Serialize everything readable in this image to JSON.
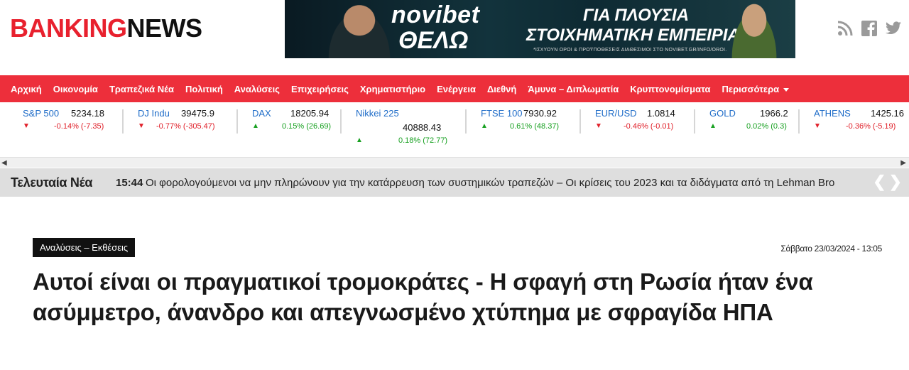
{
  "logo": {
    "part1": "BANKING",
    "part2": "NEWS"
  },
  "ad": {
    "brand": "novibet",
    "brand_line2": "ΘΕΛΩ",
    "slogan_line1": "ΓΙΑ ΠΛΟΥΣΙΑ",
    "slogan_line2": "ΣΤΟΙΧΗΜΑΤΙΚΗ ΕΜΠΕΙΡΙΑ",
    "fine_print": "*ΙΣΧΥΟΥΝ ΟΡΟΙ & ΠΡΟΫΠΟΘΕΣΕΙΣ ΔΙΑΘΕΣΙΜΟΙ ΣΤΟ NOVIBET.GR/INFO/OROI."
  },
  "social": [
    "rss-icon",
    "facebook-icon",
    "twitter-icon"
  ],
  "nav": {
    "items": [
      "Αρχική",
      "Οικονομία",
      "Τραπεζικά Νέα",
      "Πολιτική",
      "Αναλύσεις",
      "Επιχειρήσεις",
      "Χρηματιστήριο",
      "Ενέργεια",
      "Διεθνή",
      "Άμυνα – Διπλωματία",
      "Κρυπτονομίσματα"
    ],
    "more": "Περισσότερα"
  },
  "tickers": [
    {
      "name": "S&P 500",
      "price": "5234.18",
      "change": "-0.14% (-7.35)",
      "dir": "down"
    },
    {
      "name": "DJ Indu",
      "price": "39475.9",
      "change": "-0.77% (-305.47)",
      "dir": "down"
    },
    {
      "name": "DAX",
      "price": "18205.94",
      "change": "0.15% (26.69)",
      "dir": "up"
    },
    {
      "name": "Nikkei 225",
      "price": "40888.43",
      "change": "0.18% (72.77)",
      "dir": "up"
    },
    {
      "name": "FTSE 100",
      "price": "7930.92",
      "change": "0.61% (48.37)",
      "dir": "up"
    },
    {
      "name": "EUR/USD",
      "price": "1.0814",
      "change": "-0.46% (-0.01)",
      "dir": "down"
    },
    {
      "name": "GOLD",
      "price": "1966.2",
      "change": "0.02% (0.3)",
      "dir": "up"
    },
    {
      "name": "ATHENS",
      "price": "1425.16",
      "change": "-0.36% (-5.19)",
      "dir": "down"
    }
  ],
  "latest": {
    "label": "Τελευταία Νέα",
    "time": "15:44",
    "headline": "Οι φορολογούμενοι να μην πληρώνουν για την κατάρρευση των συστημικών τραπεζών – Οι κρίσεις του 2023 και τα διδάγματα από τη Lehman Bro"
  },
  "article": {
    "category": "Αναλύσεις – Εκθέσεις",
    "date": "Σάββατο 23/03/2024 - 13:05",
    "title": "Αυτοί είναι οι πραγματικοί τρομοκράτες - Η σφαγή στη Ρωσία ήταν ένα ασύμμετρο, άνανδρο και απεγνωσμένο χτύπημα με σφραγίδα ΗΠΑ"
  }
}
